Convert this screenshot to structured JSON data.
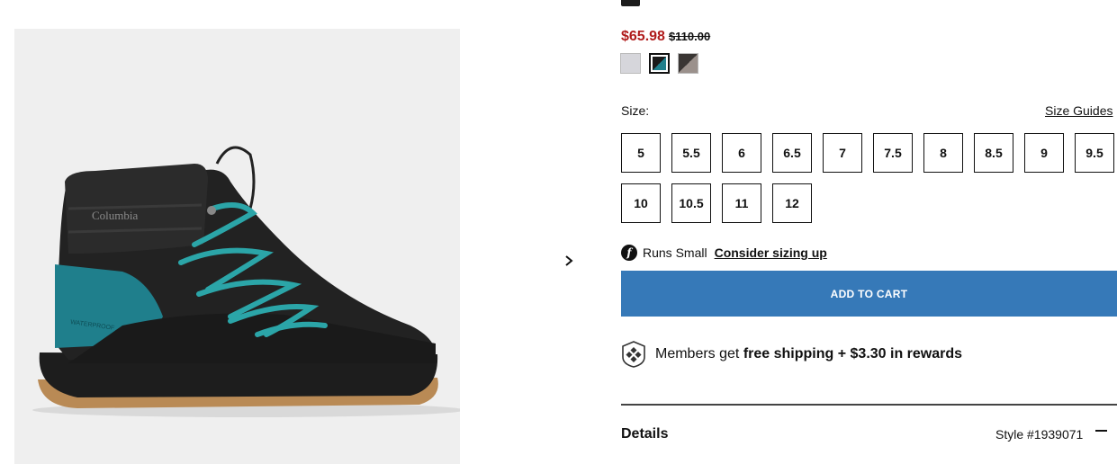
{
  "product": {
    "image_alt": "Columbia waterproof winter boot, black with teal laces and heel",
    "boot_brand_text": "Columbia",
    "boot_side_text": "WATERPROOF"
  },
  "carousel": {
    "next_icon": "chevron-right-icon"
  },
  "price": {
    "sale": "$65.98",
    "original": "$110.00",
    "sale_color": "#b01c1c"
  },
  "swatches": [
    {
      "name": "light-grey",
      "colors": [
        "#d6d6db",
        "#d6d6db"
      ],
      "selected": false
    },
    {
      "name": "black-teal",
      "colors": [
        "#1a1a1a",
        "#1f7f8c"
      ],
      "selected": true
    },
    {
      "name": "grey-taupe",
      "colors": [
        "#3a3634",
        "#9b918c"
      ],
      "selected": false
    }
  ],
  "size": {
    "label": "Size:",
    "guides_link": "Size Guides",
    "options": [
      "5",
      "5.5",
      "6",
      "6.5",
      "7",
      "7.5",
      "8",
      "8.5",
      "9",
      "9.5",
      "10",
      "10.5",
      "11",
      "12"
    ]
  },
  "fit": {
    "icon": "fit-f-icon",
    "icon_glyph": "f",
    "text": "Runs Small",
    "link": "Consider sizing up"
  },
  "cart": {
    "button_label": "ADD TO CART",
    "button_color": "#3679b8"
  },
  "members": {
    "icon": "columbia-shield-icon",
    "prefix": "Members get",
    "bold": "free shipping + $3.30 in rewards"
  },
  "details": {
    "title": "Details",
    "style": "Style #1939071",
    "toggle_icon": "minus-icon"
  }
}
